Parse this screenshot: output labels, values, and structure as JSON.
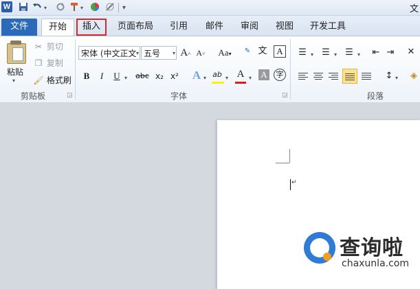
{
  "app": {
    "icon_letter": "W",
    "title_fragment": "文"
  },
  "qat": {
    "icons": [
      "save-icon",
      "undo-icon",
      "redo-icon",
      "format-painter-icon",
      "color-icon",
      "draw-icon",
      "customize-icon"
    ]
  },
  "tabs": {
    "file": "文件",
    "items": [
      {
        "label": "开始",
        "state": "active"
      },
      {
        "label": "插入",
        "state": "highlighted"
      },
      {
        "label": "页面布局",
        "state": "normal"
      },
      {
        "label": "引用",
        "state": "normal"
      },
      {
        "label": "邮件",
        "state": "normal"
      },
      {
        "label": "审阅",
        "state": "normal"
      },
      {
        "label": "视图",
        "state": "normal"
      },
      {
        "label": "开发工具",
        "state": "normal"
      }
    ],
    "highlight_color": "#d2292b"
  },
  "clipboard": {
    "paste": "粘贴",
    "cut": "剪切",
    "copy": "复制",
    "format_painter": "格式刷",
    "group_label": "剪贴板"
  },
  "font": {
    "font_name": "宋体 (中文正文",
    "font_size": "五号",
    "grow": "A",
    "shrink": "A",
    "change_case": "Aa",
    "bold": "B",
    "italic": "I",
    "underline": "U",
    "strikethrough": "abc",
    "subscript": "x₂",
    "superscript": "x²",
    "text_effect": "A",
    "highlight": "ab",
    "font_color": "A",
    "char_shading": "A",
    "enclose": "字",
    "phonetic": "文",
    "char_border": "A",
    "group_label": "字体"
  },
  "paragraph": {
    "group_label": "段落"
  },
  "watermark": {
    "title": "查询啦",
    "url": "chaxunla.com"
  },
  "colors": {
    "file_tab": "#2a6ab8",
    "highlight_yellow": "#fff200",
    "font_red": "#e01b1b",
    "watermark_blue": "#2f7bd6",
    "watermark_orange": "#f39c1e"
  }
}
